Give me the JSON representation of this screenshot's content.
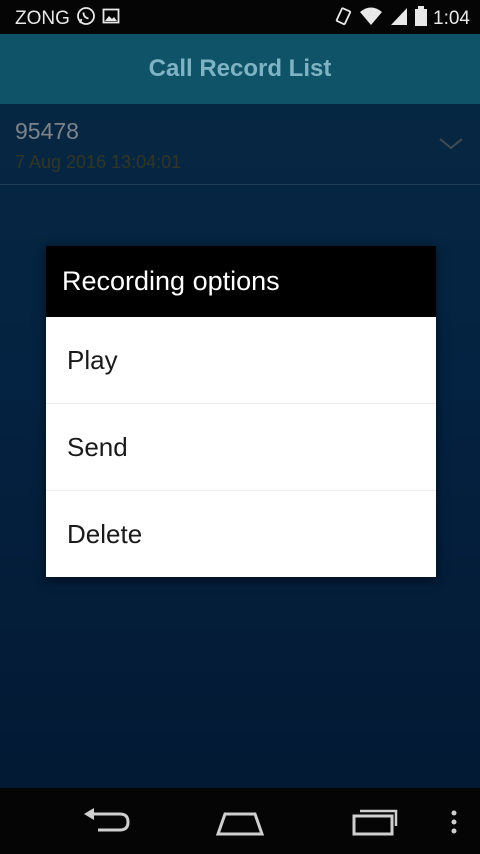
{
  "status_bar": {
    "carrier": "ZONG",
    "time": "1:04",
    "icons": [
      "whatsapp-icon",
      "image-icon",
      "vibrate-icon",
      "wifi-icon",
      "signal-icon",
      "battery-icon"
    ]
  },
  "app_bar": {
    "title": "Call Record List"
  },
  "record": {
    "number": "95478",
    "date": "7 Aug 2016 13:04:01"
  },
  "dialog": {
    "title": "Recording options",
    "items": [
      {
        "label": "Play"
      },
      {
        "label": "Send"
      },
      {
        "label": "Delete"
      }
    ]
  },
  "nav_bar": {
    "icons": [
      "back-icon",
      "home-icon",
      "recent-apps-icon",
      "overflow-menu-icon"
    ]
  },
  "colors": {
    "app_bar": "#0f5368",
    "app_bar_text": "#7fb2c2",
    "background": "#07305d",
    "dialog_title_bg": "#000000"
  }
}
